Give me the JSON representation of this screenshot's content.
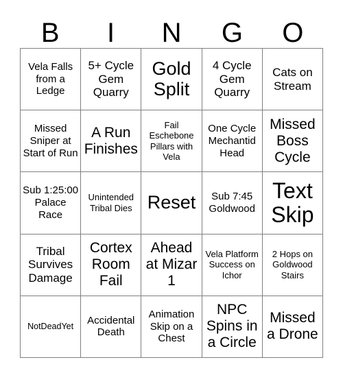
{
  "card": {
    "title": "BINGO",
    "headers": [
      "B",
      "I",
      "N",
      "G",
      "O"
    ],
    "rows": [
      [
        {
          "text": "Vela Falls from a Ledge",
          "size": "sm"
        },
        {
          "text": "5+ Cycle Gem Quarry",
          "size": "md"
        },
        {
          "text": "Gold Split",
          "size": "xl"
        },
        {
          "text": "4 Cycle Gem Quarry",
          "size": "md"
        },
        {
          "text": "Cats on Stream",
          "size": "md"
        }
      ],
      [
        {
          "text": "Missed Sniper at Start of Run",
          "size": "sm"
        },
        {
          "text": "A Run Finishes",
          "size": "lg"
        },
        {
          "text": "Fail Eschebone Pillars with Vela",
          "size": "xs"
        },
        {
          "text": "One Cycle Mechantid Head",
          "size": "sm"
        },
        {
          "text": "Missed Boss Cycle",
          "size": "lg"
        }
      ],
      [
        {
          "text": "Sub 1:25:00 Palace Race",
          "size": "sm"
        },
        {
          "text": "Unintended Tribal Dies",
          "size": "xs"
        },
        {
          "text": "Reset",
          "size": "xl"
        },
        {
          "text": "Sub 7:45 Goldwood",
          "size": "sm"
        },
        {
          "text": "Text Skip",
          "size": "xxl"
        }
      ],
      [
        {
          "text": "Tribal Survives Damage",
          "size": "md"
        },
        {
          "text": "Cortex Room Fail",
          "size": "lg"
        },
        {
          "text": "Ahead at Mizar 1",
          "size": "lg"
        },
        {
          "text": "Vela Platform Success on Ichor",
          "size": "xs"
        },
        {
          "text": "2 Hops on Goldwood Stairs",
          "size": "xs"
        }
      ],
      [
        {
          "text": "NotDeadYet",
          "size": "xxs"
        },
        {
          "text": "Accidental Death",
          "size": "sm"
        },
        {
          "text": "Animation Skip on a Chest",
          "size": "sm"
        },
        {
          "text": "NPC Spins in a Circle",
          "size": "lg"
        },
        {
          "text": "Missed a Drone",
          "size": "lg"
        }
      ]
    ]
  },
  "colors": {
    "background": "#ffffff",
    "text": "#000000",
    "grid_line": "#808080"
  }
}
